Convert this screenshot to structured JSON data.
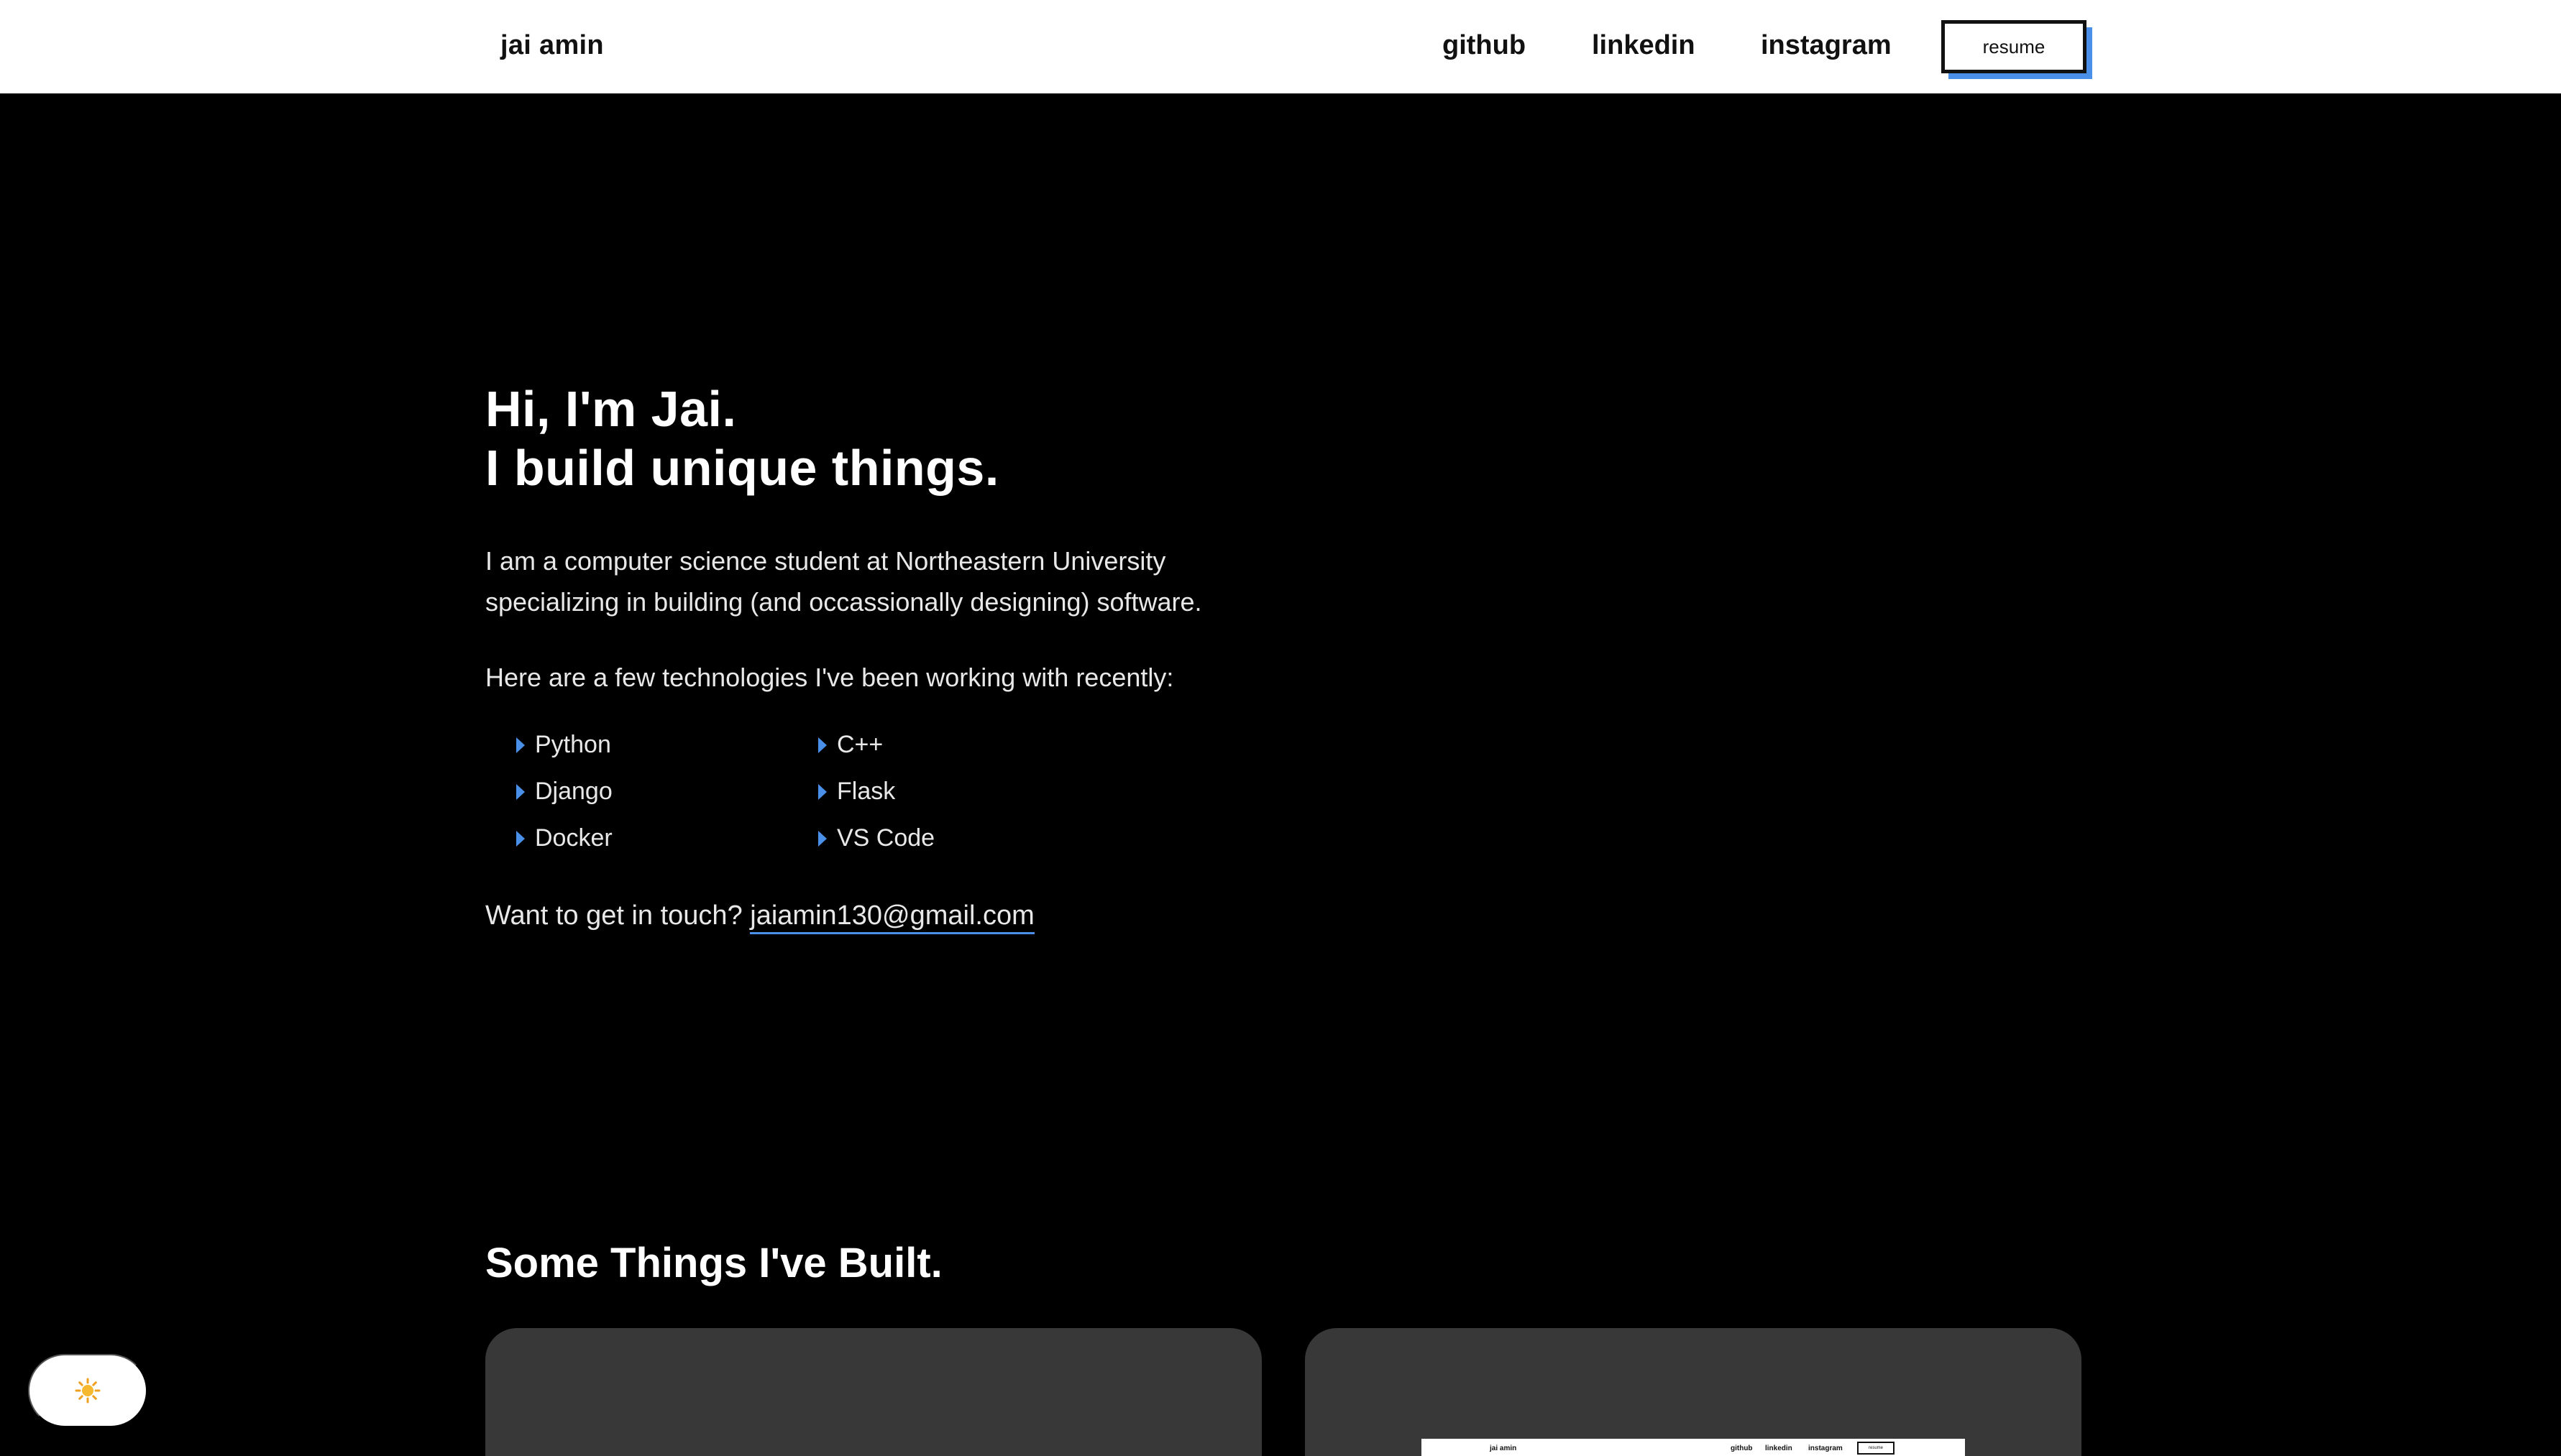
{
  "header": {
    "brand": "jai amin",
    "nav": {
      "github": "github",
      "linkedin": "linkedin",
      "instagram": "instagram"
    },
    "resume_label": "resume"
  },
  "hero": {
    "title_line1": "Hi, I'm Jai.",
    "title_line2": "I build unique things.",
    "desc_line1": "I am a computer science student at Northeastern University",
    "desc_line2": "specializing in building (and occassionally designing) software.",
    "tech_intro": "Here are a few technologies I've been working with recently:",
    "technologies": [
      "Python",
      "C++",
      "Django",
      "Flask",
      "Docker",
      "VS Code"
    ],
    "contact_prompt": "Want to get in touch?",
    "contact_email": "jaiamin130@gmail.com"
  },
  "projects": {
    "section_title": "Some Things I've Built.",
    "thumbnail": {
      "brand": "jai amin",
      "github": "github",
      "linkedin": "linkedin",
      "instagram": "instagram",
      "resume": "resume"
    }
  },
  "theme_toggle": {
    "icon": "sun-icon"
  },
  "colors": {
    "accent": "#4a90e8",
    "background": "#000000",
    "header_bg": "#ffffff",
    "card_bg": "#383838",
    "text": "#e8e8e8"
  }
}
